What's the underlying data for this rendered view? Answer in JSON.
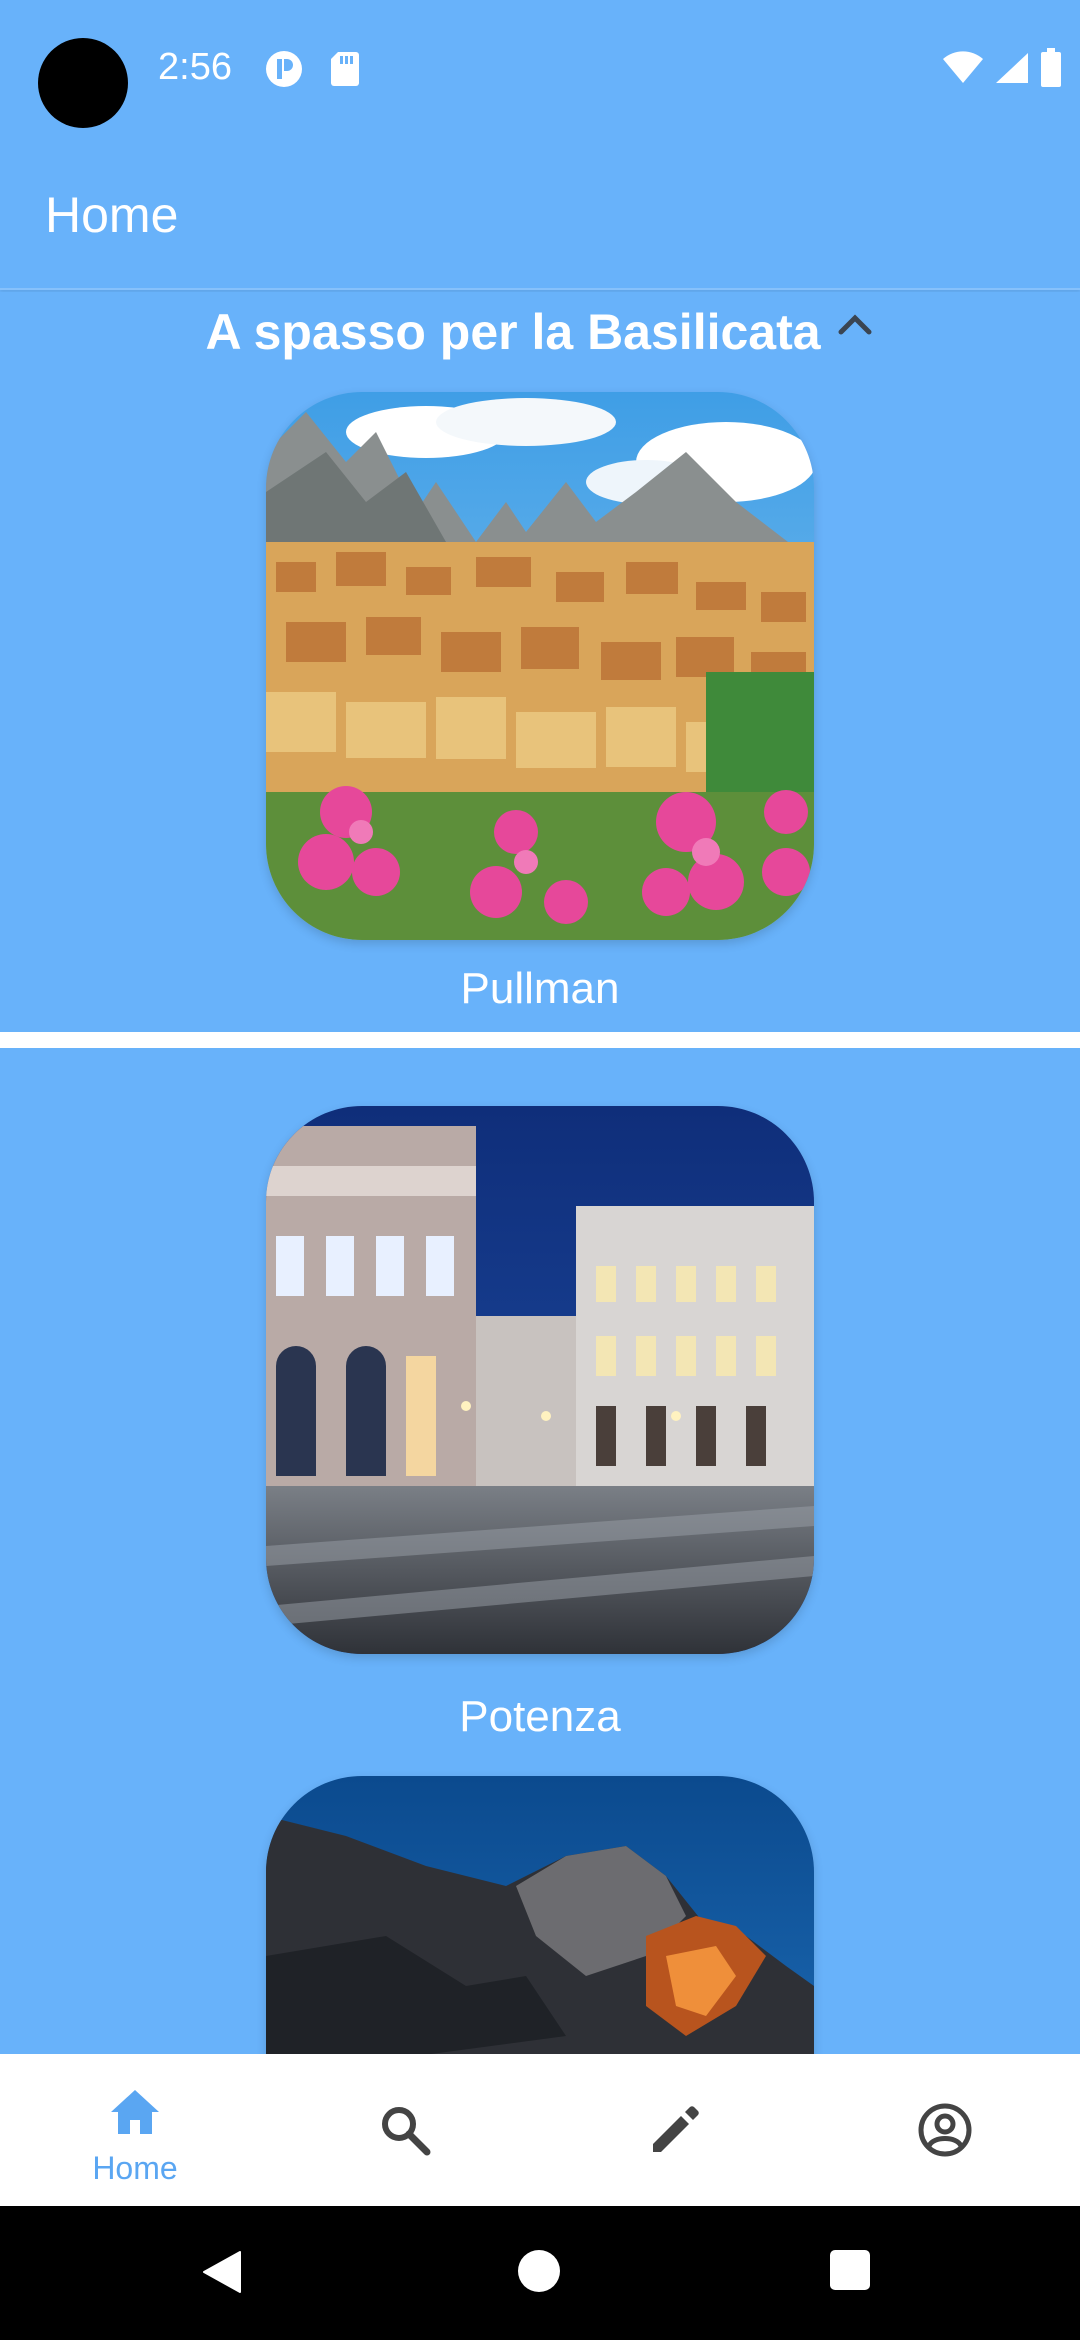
{
  "status_bar": {
    "time": "2:56",
    "icons": [
      "notification-p-icon",
      "sd-card-icon",
      "wifi-icon",
      "signal-icon",
      "battery-icon"
    ]
  },
  "app_bar": {
    "title": "Home"
  },
  "section": {
    "title": "A spasso per la Basilicata",
    "toggle_icon": "chevron-up-icon"
  },
  "cards": [
    {
      "label": "Pullman",
      "image": "village-mountains-photo"
    },
    {
      "label": "Potenza",
      "image": "city-square-night-photo"
    },
    {
      "label": "",
      "image": "rocks-night-photo"
    }
  ],
  "bottom_nav": {
    "items": [
      {
        "label": "Home",
        "icon": "home-icon",
        "active": true
      },
      {
        "label": "",
        "icon": "search-icon",
        "active": false
      },
      {
        "label": "",
        "icon": "edit-pencil-icon",
        "active": false
      },
      {
        "label": "",
        "icon": "account-circle-icon",
        "active": false
      }
    ]
  },
  "colors": {
    "primary": "#68b2fa",
    "nav_active": "#5aa6f2",
    "nav_inactive": "#444444"
  }
}
